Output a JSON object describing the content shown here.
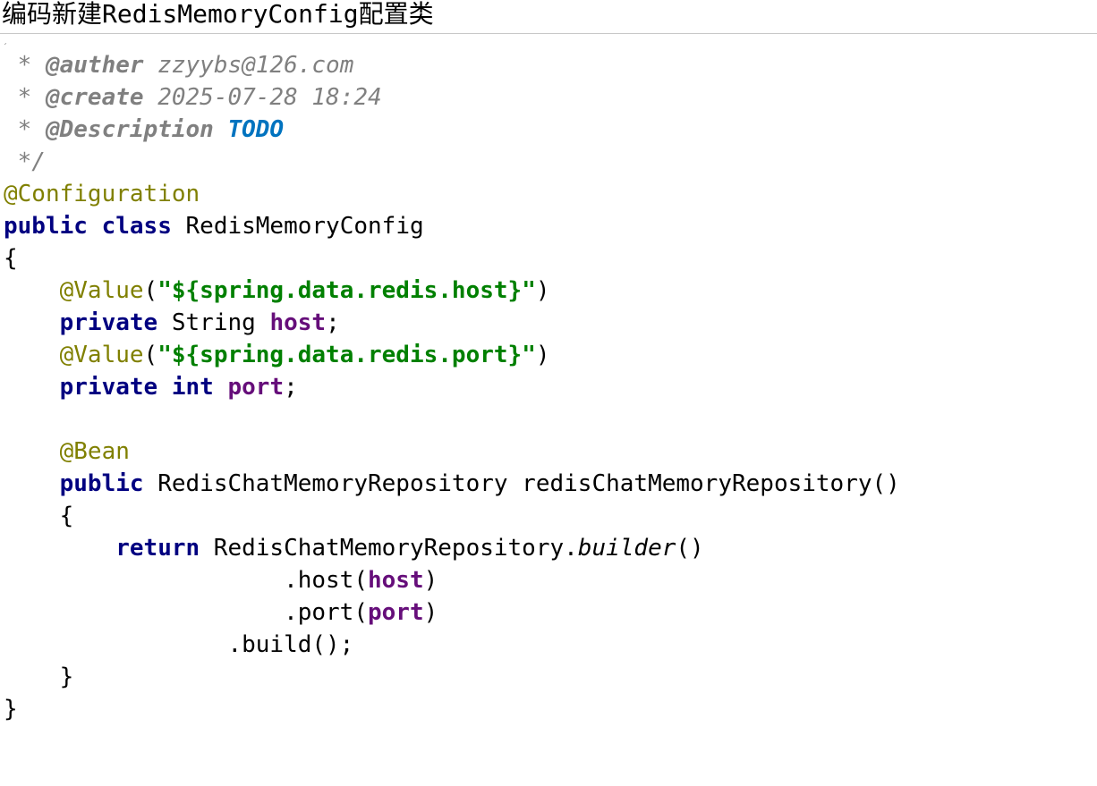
{
  "header": {
    "title": "编码新建RedisMemoryConfig配置类"
  },
  "editor": {
    "top_mark": "ˏ",
    "lines": [
      [
        {
          "t": " * ",
          "c": "doc"
        },
        {
          "t": "@auther",
          "c": "doc-tag"
        },
        {
          "t": " zzyybs@126.com",
          "c": "doc"
        }
      ],
      [
        {
          "t": " * ",
          "c": "doc"
        },
        {
          "t": "@create",
          "c": "doc-tag"
        },
        {
          "t": " 2025-07-28 18:24",
          "c": "doc"
        }
      ],
      [
        {
          "t": " * ",
          "c": "doc"
        },
        {
          "t": "@Description",
          "c": "doc-tag"
        },
        {
          "t": " ",
          "c": "doc"
        },
        {
          "t": "TODO",
          "c": "todo"
        }
      ],
      [
        {
          "t": " */",
          "c": "doc"
        }
      ],
      [
        {
          "t": "@Configuration",
          "c": "annotation"
        }
      ],
      [
        {
          "t": "public",
          "c": "keyword"
        },
        {
          "t": " ",
          "c": "plain"
        },
        {
          "t": "class",
          "c": "keyword"
        },
        {
          "t": " RedisMemoryConfig",
          "c": "plain"
        }
      ],
      [
        {
          "t": "{",
          "c": "plain"
        }
      ],
      [
        {
          "t": "    ",
          "c": "plain"
        },
        {
          "t": "@Value",
          "c": "annotation"
        },
        {
          "t": "(",
          "c": "plain"
        },
        {
          "t": "\"${spring.data.redis.host}\"",
          "c": "string"
        },
        {
          "t": ")",
          "c": "plain"
        }
      ],
      [
        {
          "t": "    ",
          "c": "plain"
        },
        {
          "t": "private",
          "c": "keyword"
        },
        {
          "t": " String ",
          "c": "plain"
        },
        {
          "t": "host",
          "c": "field"
        },
        {
          "t": ";",
          "c": "plain"
        }
      ],
      [
        {
          "t": "    ",
          "c": "plain"
        },
        {
          "t": "@Value",
          "c": "annotation"
        },
        {
          "t": "(",
          "c": "plain"
        },
        {
          "t": "\"${spring.data.redis.port}\"",
          "c": "string"
        },
        {
          "t": ")",
          "c": "plain"
        }
      ],
      [
        {
          "t": "    ",
          "c": "plain"
        },
        {
          "t": "private",
          "c": "keyword"
        },
        {
          "t": " ",
          "c": "plain"
        },
        {
          "t": "int",
          "c": "keyword"
        },
        {
          "t": " ",
          "c": "plain"
        },
        {
          "t": "port",
          "c": "field"
        },
        {
          "t": ";",
          "c": "plain"
        }
      ],
      [],
      [
        {
          "t": "    ",
          "c": "plain"
        },
        {
          "t": "@Bean",
          "c": "annotation"
        }
      ],
      [
        {
          "t": "    ",
          "c": "plain"
        },
        {
          "t": "public",
          "c": "keyword"
        },
        {
          "t": " RedisChatMemoryRepository redisChatMemoryRepository()",
          "c": "plain"
        }
      ],
      [
        {
          "t": "    {",
          "c": "plain"
        }
      ],
      [
        {
          "t": "        ",
          "c": "plain"
        },
        {
          "t": "return",
          "c": "keyword"
        },
        {
          "t": " RedisChatMemoryRepository.",
          "c": "plain"
        },
        {
          "t": "builder",
          "c": "static-call"
        },
        {
          "t": "()",
          "c": "plain"
        }
      ],
      [
        {
          "t": "                    .host(",
          "c": "plain"
        },
        {
          "t": "host",
          "c": "field"
        },
        {
          "t": ")",
          "c": "plain"
        }
      ],
      [
        {
          "t": "                    .port(",
          "c": "plain"
        },
        {
          "t": "port",
          "c": "field"
        },
        {
          "t": ")",
          "c": "plain"
        }
      ],
      [
        {
          "t": "                .build();",
          "c": "plain"
        }
      ],
      [
        {
          "t": "    }",
          "c": "plain"
        }
      ],
      [
        {
          "t": "}",
          "c": "plain"
        }
      ]
    ]
  },
  "token_colors": {
    "doc": "#808080",
    "todo": "#0073bf",
    "annotation": "#808000",
    "keyword": "#000080",
    "string": "#008000",
    "field": "#660e7a",
    "plain": "#000000"
  }
}
